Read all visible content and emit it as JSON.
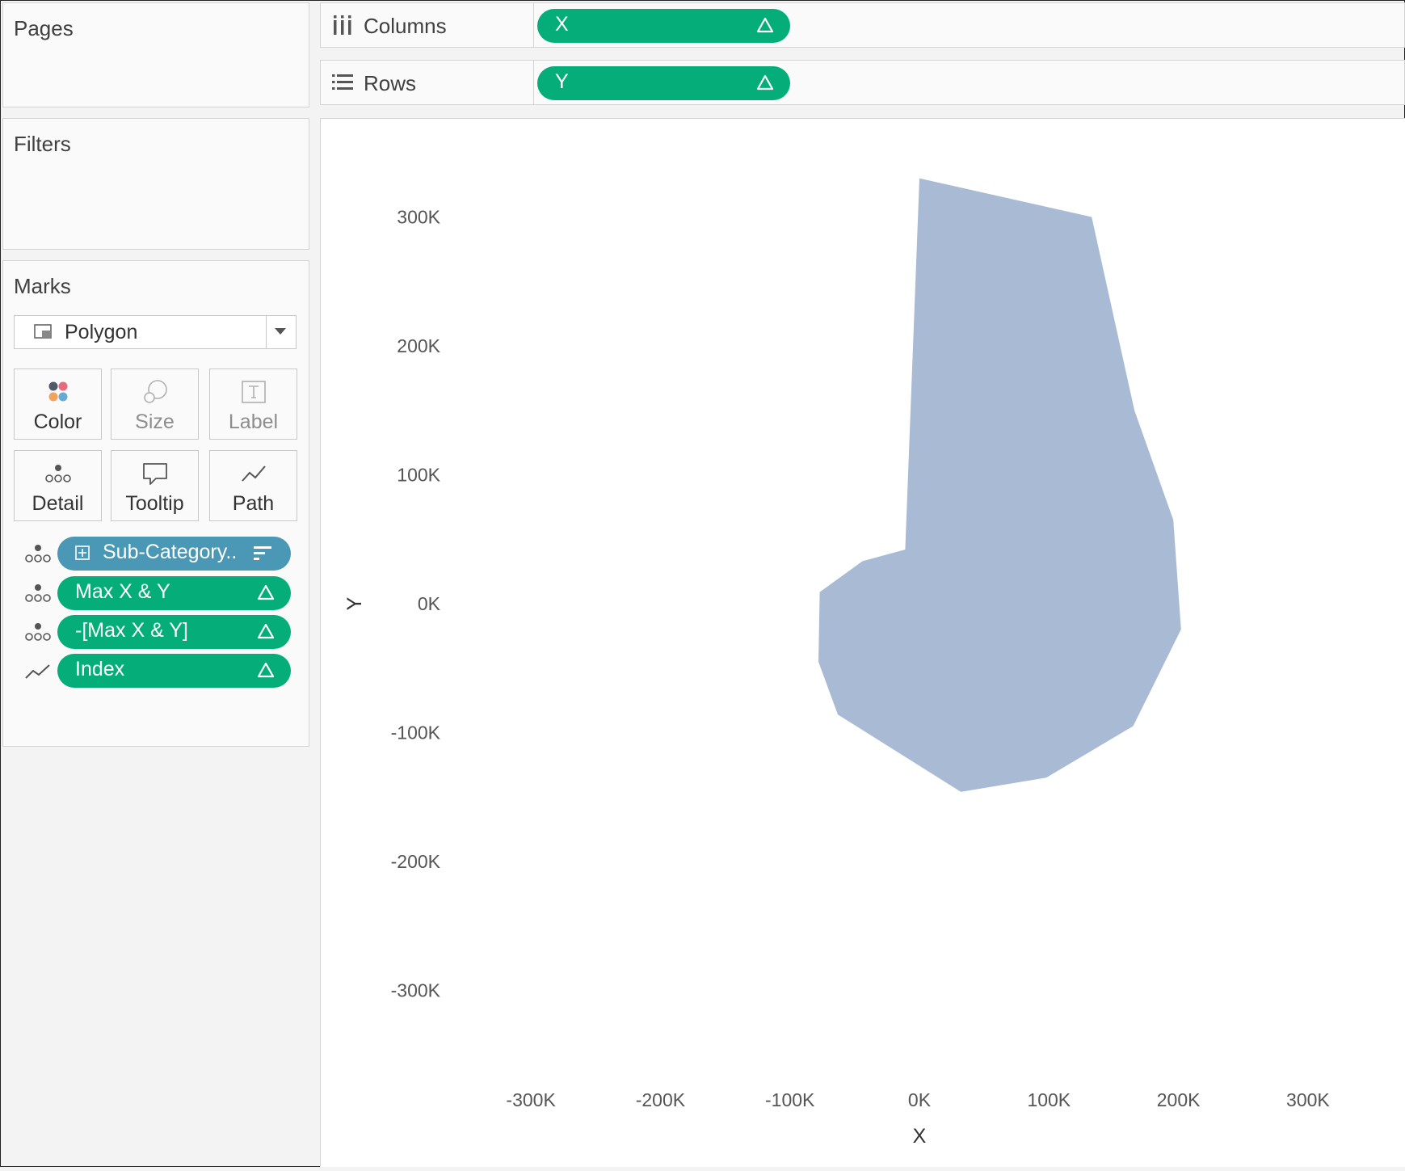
{
  "pages": {
    "title": "Pages"
  },
  "filters": {
    "title": "Filters"
  },
  "marks": {
    "title": "Marks",
    "mark_type": "Polygon",
    "cards": {
      "color": "Color",
      "size": "Size",
      "label": "Label",
      "detail": "Detail",
      "tooltip": "Tooltip",
      "path": "Path"
    },
    "fields": [
      {
        "label": "Sub-Category..",
        "encoding": "detail"
      },
      {
        "label": "Max X & Y",
        "encoding": "detail"
      },
      {
        "label": "-[Max X & Y]",
        "encoding": "detail"
      },
      {
        "label": "Index",
        "encoding": "path"
      }
    ]
  },
  "shelves": {
    "columns": {
      "label": "Columns",
      "pill": "X"
    },
    "rows": {
      "label": "Rows",
      "pill": "Y"
    }
  },
  "colors": {
    "green_pill": "#05ae79",
    "blue_pill": "#4a98b5",
    "polygon_fill": "#a9bbd4"
  },
  "chart_data": {
    "type": "polygon",
    "xlabel": "X",
    "ylabel": "Y",
    "xlim": [
      -300000,
      300000
    ],
    "ylim": [
      -300000,
      300000
    ],
    "x_ticks": [
      "-300K",
      "-200K",
      "-100K",
      "0K",
      "100K",
      "200K",
      "300K"
    ],
    "y_ticks": [
      "300K",
      "200K",
      "100K",
      "0K",
      "-100K",
      "-200K",
      "-300K"
    ],
    "grid": false,
    "series": [
      {
        "points": [
          [
            0,
            330000
          ],
          [
            133000,
            300000
          ],
          [
            166000,
            150000
          ],
          [
            196000,
            65000
          ],
          [
            202000,
            -20000
          ],
          [
            165000,
            -95000
          ],
          [
            98000,
            -135000
          ],
          [
            32000,
            -146000
          ],
          [
            -63000,
            -86000
          ],
          [
            -78000,
            -45000
          ],
          [
            -77000,
            9000
          ],
          [
            -44000,
            33000
          ],
          [
            -11000,
            42000
          ]
        ]
      }
    ]
  }
}
